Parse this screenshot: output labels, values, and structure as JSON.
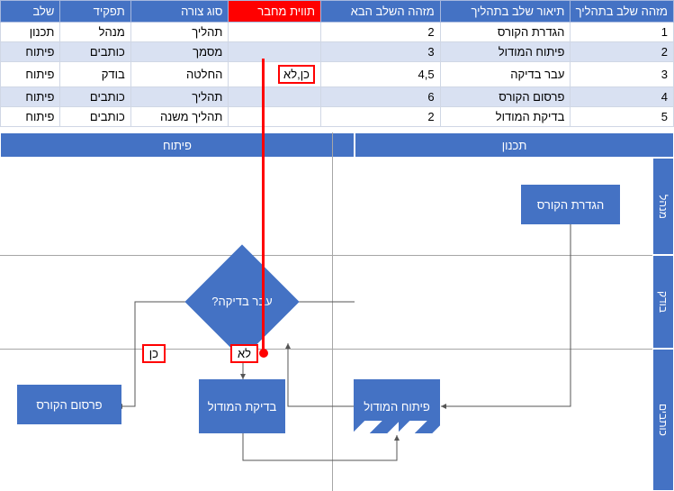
{
  "table": {
    "headers": {
      "step_id": "מזהה שלב בתהליך",
      "step_desc": "תיאור שלב בתהליך",
      "next_id": "מזהה השלב הבא",
      "connector": "תווית מחבר",
      "shape": "סוג צורה",
      "role": "תפקיד",
      "phase": "שלב"
    },
    "rows": [
      {
        "id": "1",
        "desc": "הגדרת הקורס",
        "next": "2",
        "conn": "",
        "shape": "תהליך",
        "role": "מנהל",
        "phase": "תכנון"
      },
      {
        "id": "2",
        "desc": "פיתוח המודול",
        "next": "3",
        "conn": "",
        "shape": "מסמך",
        "role": "כותבים",
        "phase": "פיתוח"
      },
      {
        "id": "3",
        "desc": "עבר בדיקה",
        "next": "4,5",
        "conn": "כן,לא",
        "shape": "החלטה",
        "role": "בודק",
        "phase": "פיתוח"
      },
      {
        "id": "4",
        "desc": "פרסום הקורס",
        "next": "6",
        "conn": "",
        "shape": "תהליך",
        "role": "כותבים",
        "phase": "פיתוח"
      },
      {
        "id": "5",
        "desc": "בדיקת המודול",
        "next": "2",
        "conn": "",
        "shape": "תהליך משנה",
        "role": "כותבים",
        "phase": "פיתוח"
      }
    ]
  },
  "swimlanes": {
    "phase_plan": "תכנון",
    "phase_dev": "פיתוח",
    "role_manager": "מנהל",
    "role_checker": "בודק",
    "role_writers": "כותבים"
  },
  "shapes": {
    "course_def": "הגדרת הקורס",
    "pass_check": "עבר בדיקה?",
    "mod_dev": "פיתוח המודול",
    "mod_check": "בדיקת המודול",
    "publish": "פרסום הקורס"
  },
  "labels": {
    "no": "לא",
    "yes": "כן"
  },
  "colors": {
    "primary": "#4472c4",
    "highlight": "#ff0000"
  }
}
